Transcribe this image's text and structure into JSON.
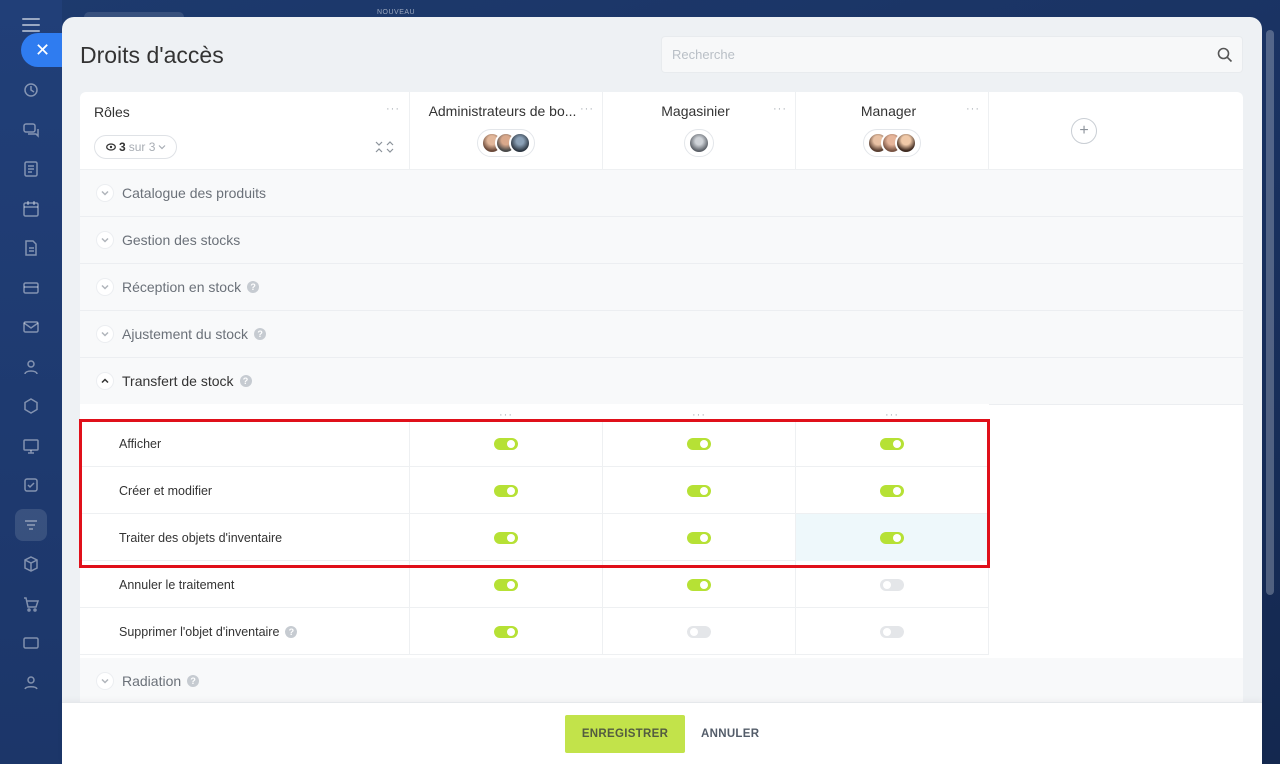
{
  "window": {
    "title": "Droits d'accès",
    "new_badge": "NOUVEAU"
  },
  "search": {
    "placeholder": "Recherche"
  },
  "header": {
    "roles_label": "Rôles",
    "visible_count": "3",
    "count_suffix": "sur 3",
    "roles": [
      {
        "name": "Administrateurs de bo...",
        "avatars": 3
      },
      {
        "name": "Magasinier",
        "avatars": 1
      },
      {
        "name": "Manager",
        "avatars": 3
      }
    ],
    "add_role": "+"
  },
  "sections": [
    {
      "label": "Catalogue des produits",
      "expanded": false,
      "help": false
    },
    {
      "label": "Gestion des stocks",
      "expanded": false,
      "help": false
    },
    {
      "label": "Réception en stock",
      "expanded": false,
      "help": true
    },
    {
      "label": "Ajustement du stock",
      "expanded": false,
      "help": true
    },
    {
      "label": "Transfert de stock",
      "expanded": true,
      "help": true
    },
    {
      "label": "Radiation",
      "expanded": false,
      "help": true
    }
  ],
  "permissions": [
    {
      "label": "Afficher",
      "help": false,
      "values": [
        true,
        true,
        true
      ]
    },
    {
      "label": "Créer et modifier",
      "help": false,
      "values": [
        true,
        true,
        true
      ]
    },
    {
      "label": "Traiter des objets d'inventaire",
      "help": false,
      "values": [
        true,
        true,
        true
      ]
    },
    {
      "label": "Annuler le traitement",
      "help": false,
      "values": [
        true,
        true,
        false
      ]
    },
    {
      "label": "Supprimer l'objet d'inventaire",
      "help": true,
      "values": [
        true,
        false,
        false
      ]
    }
  ],
  "footer": {
    "save_label": "ENREGISTRER",
    "cancel_label": "ANNULER"
  },
  "colors": {
    "accent_green": "#b6e135",
    "save_green": "#c2e34a",
    "highlight_red": "#e0101a",
    "close_blue": "#2f7cf0"
  }
}
